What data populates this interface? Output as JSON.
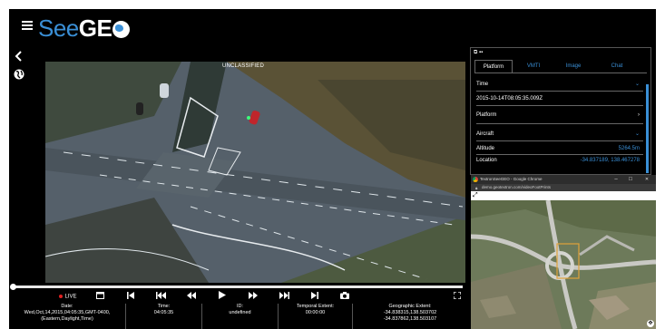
{
  "header": {
    "logo_prefix": "See",
    "logo_bold": "GE",
    "logo_glyph": "globe-o"
  },
  "left_controls": {
    "back_icon": "chevron-left-icon",
    "globe_icon": "globe-icon"
  },
  "video": {
    "classification": "UNCLASSIFIED"
  },
  "controls": {
    "live_label": "LIVE",
    "buttons": [
      "caption-icon",
      "skip-start-icon",
      "fast-rewind-icon",
      "rewind-icon",
      "play-icon",
      "fast-forward-icon",
      "skip-forward-icon",
      "skip-end-icon",
      "camera-icon",
      "fullscreen-icon"
    ],
    "progress": 0.0
  },
  "status": {
    "date_label": "Date:",
    "date_value_1": "Wed,Oct,14,2015,04:05:35,GMT-0400,",
    "date_value_2": "(Eastern,Daylight,Time)",
    "time_label": "Time:",
    "time_value": "04:05:35",
    "id_label": "ID:",
    "id_value": "undefined",
    "temporal_label": "Temporal Extent:",
    "temporal_value": "00:00:00",
    "geo_label": "Geographic Extent:",
    "geo_value_1": "-34.838315,138.503702",
    "geo_value_2": "-34.837862,138.503107"
  },
  "panel": {
    "tabs": [
      "Platform",
      "VMTI",
      "Image",
      "Chat"
    ],
    "active_tab": "Platform",
    "time_label": "Time",
    "time_value": "2015-10-14T08:05:35.009Z",
    "platform_label": "Platform",
    "aircraft_label": "Aircraft",
    "altitude_label": "Altitude",
    "altitude_value": "5264.5m",
    "location_label": "Location",
    "location_value": "-34.837189, 138.467278",
    "accent_color": "#3a8fd6"
  },
  "map_window": {
    "title": "TextronSeeGEO - Google Chrome",
    "url": "demo.geotextron.com/videoFootPrints",
    "min_label": "–",
    "max_label": "☐",
    "close_label": "✕"
  }
}
